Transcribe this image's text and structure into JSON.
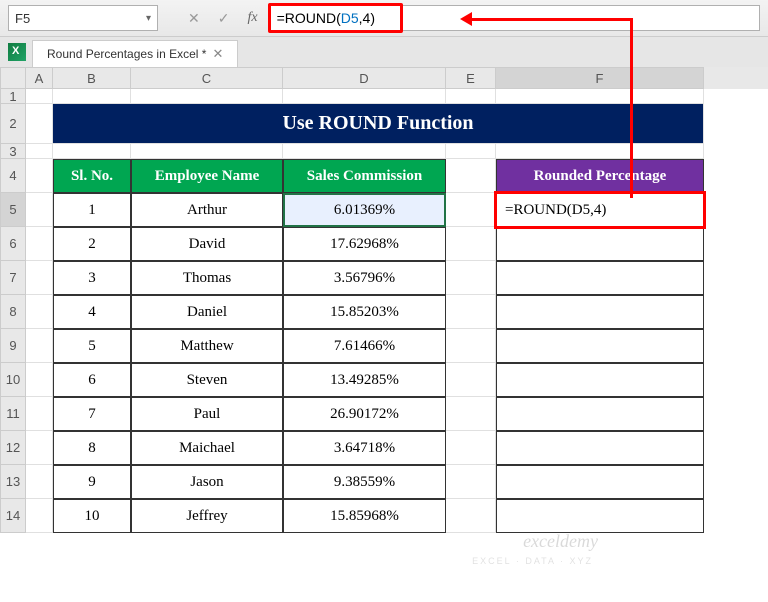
{
  "namebox": {
    "value": "F5"
  },
  "formula_bar": {
    "value": "=ROUND(D5,4)",
    "prefix": "=ROUND(",
    "ref": "D5",
    "suffix": ",4)"
  },
  "sheet_tab": {
    "label": "Round Percentages in Excel *"
  },
  "columns": [
    "A",
    "B",
    "C",
    "D",
    "E",
    "F"
  ],
  "title": "Use ROUND Function",
  "headers": {
    "sl": "Sl. No.",
    "emp": "Employee Name",
    "comm": "Sales Commission",
    "rounded": "Rounded Percentage"
  },
  "rows": [
    {
      "sl": "1",
      "emp": "Arthur",
      "comm": "6.01369%"
    },
    {
      "sl": "2",
      "emp": "David",
      "comm": "17.62968%"
    },
    {
      "sl": "3",
      "emp": "Thomas",
      "comm": "3.56796%"
    },
    {
      "sl": "4",
      "emp": "Daniel",
      "comm": "15.85203%"
    },
    {
      "sl": "5",
      "emp": "Matthew",
      "comm": "7.61466%"
    },
    {
      "sl": "6",
      "emp": "Steven",
      "comm": "13.49285%"
    },
    {
      "sl": "7",
      "emp": "Paul",
      "comm": "26.90172%"
    },
    {
      "sl": "8",
      "emp": "Maichael",
      "comm": "3.64718%"
    },
    {
      "sl": "9",
      "emp": "Jason",
      "comm": "9.38559%"
    },
    {
      "sl": "10",
      "emp": "Jeffrey",
      "comm": "15.85968%"
    }
  ],
  "active_cell_display": "=ROUND(D5,4)",
  "watermark": {
    "main": "exceldemy",
    "sub": "EXCEL · DATA · XYZ"
  }
}
